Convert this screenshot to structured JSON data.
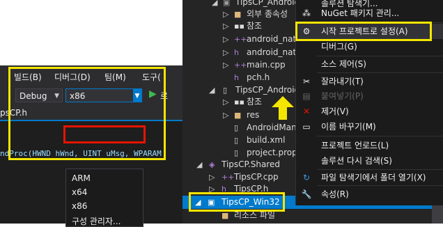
{
  "left": {
    "menu": [
      "빌드(B)",
      "디버그(D)",
      "팀(M)",
      "도구("
    ],
    "toolbar": {
      "config": "Debug",
      "platform": "x86",
      "play_partial": "로"
    },
    "tab": "psCP.h",
    "dropdown": [
      "ARM",
      "x64",
      "x86",
      "구성 관리자..."
    ],
    "code_line": "ndProc(HWND hWnd, UINT uMsg, WPARAM"
  },
  "tree": [
    {
      "label": "TipsCP_Android",
      "icon": "project"
    },
    {
      "label": "외부 종속성",
      "icon": "folder"
    },
    {
      "label": "참조",
      "icon": "refs"
    },
    {
      "label": "android_nati",
      "icon": "cpp"
    },
    {
      "label": "android_nati",
      "icon": "file"
    },
    {
      "label": "main.cpp",
      "icon": "cpp"
    },
    {
      "label": "pch.h",
      "icon": "header"
    },
    {
      "label": "TipsCP_Android",
      "icon": "phone"
    },
    {
      "label": "참조",
      "icon": "refs"
    },
    {
      "label": "res",
      "icon": "folder"
    },
    {
      "label": "AndroidMan",
      "icon": "file"
    },
    {
      "label": "build.xml",
      "icon": "file"
    },
    {
      "label": "project.prope",
      "icon": "file"
    },
    {
      "label": "TipsCP.Shared",
      "icon": "shared"
    },
    {
      "label": "TipsCP.cpp",
      "icon": "cpp"
    },
    {
      "label": "TipsCP.h",
      "icon": "header"
    },
    {
      "label": "TipsCP_Win32",
      "icon": "project"
    },
    {
      "label": "리소스 파일",
      "icon": "folder"
    }
  ],
  "context_menu": [
    {
      "label": "솔루션 탐색기...",
      "icon": "none"
    },
    {
      "label": "NuGet 패키지 관리...",
      "icon": "nuget"
    },
    {
      "label": "시작 프로젝트로 설정(A)",
      "icon": "gear"
    },
    {
      "label": "디버그(G)",
      "icon": "none"
    },
    {
      "label": "소스 제어(S)",
      "icon": "none"
    },
    {
      "label": "잘라내기(T)",
      "icon": "scissors"
    },
    {
      "label": "붙여넣기(P)",
      "icon": "paste"
    },
    {
      "label": "제거(V)",
      "icon": "x"
    },
    {
      "label": "이름 바꾸기(M)",
      "icon": "rename"
    },
    {
      "label": "프로젝트 언로드(L)",
      "icon": "none"
    },
    {
      "label": "솔루션 다시 검색(S)",
      "icon": "none"
    },
    {
      "label": "파일 탐색기에서 폴더 열기(X)",
      "icon": "refresh"
    },
    {
      "label": "속성(R)",
      "icon": "wrench"
    }
  ],
  "colors": {
    "highlight": "#f5e600",
    "selected": "#007acc",
    "remove": "#e51400",
    "background": "#252526"
  }
}
